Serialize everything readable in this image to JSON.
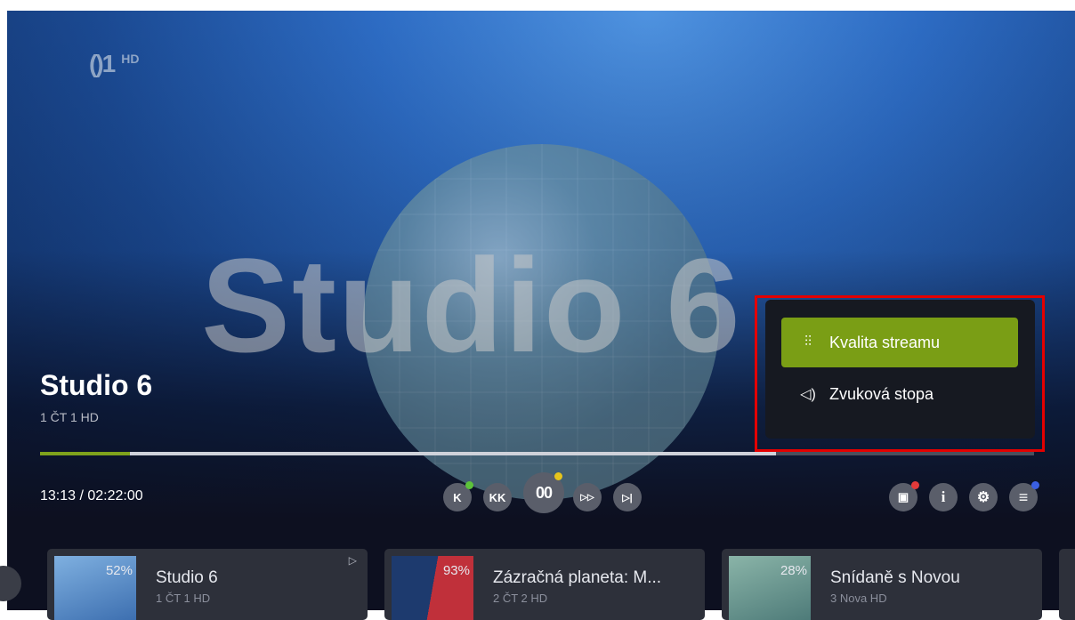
{
  "channel_logo": {
    "mark": "()1",
    "suffix": "HD"
  },
  "background_title": "Studio 6",
  "program": {
    "title": "Studio 6",
    "channel": "1 ČT 1 HD"
  },
  "playback": {
    "time": "13:13 / 02:22:00",
    "played_fraction": 0.09,
    "buffered_fraction": 0.74
  },
  "controls": {
    "skip_prev": "K",
    "rewind": "K​K",
    "play_pause": "0 0",
    "fast_forward": "▷▷",
    "skip_next": "▷|",
    "record": "▣",
    "info": "i",
    "settings": "⚙",
    "menu": "≡"
  },
  "remote_dot_colors": {
    "green": "#5cc23a",
    "yellow": "#e6c41c",
    "red": "#e23a3a",
    "blue": "#3a5fe2"
  },
  "settings_menu": {
    "items": [
      {
        "label": "Kvalita streamu",
        "icon": "equalizer-icon",
        "active": true
      },
      {
        "label": "Zvuková stopa",
        "icon": "speaker-icon",
        "active": false
      }
    ]
  },
  "accent_color": "#7a9e15",
  "highlight_color": "#e40000",
  "cards": [
    {
      "percent": "52%",
      "title": "Studio 6",
      "subtitle": "1 ČT 1 HD",
      "progress": 0.52
    },
    {
      "percent": "93%",
      "title": "Zázračná planeta: M...",
      "subtitle": "2 ČT 2 HD",
      "progress": 0.93
    },
    {
      "percent": "28%",
      "title": "Snídaně s Novou",
      "subtitle": "3 Nova HD",
      "progress": 0.28
    }
  ]
}
